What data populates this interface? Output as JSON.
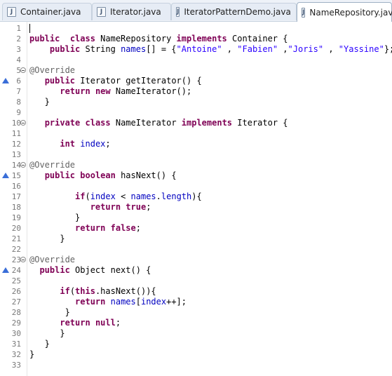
{
  "tabs": [
    {
      "label": "Container.java",
      "icon": "java-file-icon",
      "active": false
    },
    {
      "label": "Iterator.java",
      "icon": "java-file-icon",
      "active": false
    },
    {
      "label": "IteratorPatternDemo.java",
      "icon": "java-file-icon",
      "active": false
    },
    {
      "label": "NameRepository.java",
      "icon": "java-file-icon",
      "active": true
    }
  ],
  "lines": [
    {
      "n": "1",
      "t": []
    },
    {
      "n": "2",
      "t": [
        [
          "kw",
          "public"
        ],
        [
          "",
          "  "
        ],
        [
          "kw",
          "class"
        ],
        [
          "",
          " NameRepository "
        ],
        [
          "kw",
          "implements"
        ],
        [
          "",
          " Container {"
        ]
      ]
    },
    {
      "n": "3",
      "t": [
        [
          "",
          "    "
        ],
        [
          "kw",
          "public"
        ],
        [
          "",
          " String "
        ],
        [
          "fld",
          "names"
        ],
        [
          "",
          "[] = {"
        ],
        [
          "str",
          "\"Antoine\""
        ],
        [
          "",
          " , "
        ],
        [
          "str",
          "\"Fabien\""
        ],
        [
          "",
          " ,"
        ],
        [
          "str",
          "\"Joris\""
        ],
        [
          "",
          " , "
        ],
        [
          "str",
          "\"Yassine\""
        ],
        [
          "",
          "};"
        ]
      ]
    },
    {
      "n": "4",
      "t": []
    },
    {
      "n": "5",
      "fold": true,
      "t": [
        [
          "ann",
          "@Override"
        ]
      ]
    },
    {
      "n": "6",
      "override": true,
      "t": [
        [
          "",
          "   "
        ],
        [
          "kw",
          "public"
        ],
        [
          "",
          " Iterator getIterator() {"
        ]
      ]
    },
    {
      "n": "7",
      "t": [
        [
          "",
          "      "
        ],
        [
          "kw",
          "return"
        ],
        [
          "",
          " "
        ],
        [
          "kw",
          "new"
        ],
        [
          "",
          " NameIterator();"
        ]
      ]
    },
    {
      "n": "8",
      "t": [
        [
          "",
          "   }"
        ]
      ]
    },
    {
      "n": "9",
      "t": []
    },
    {
      "n": "10",
      "fold": true,
      "t": [
        [
          "",
          "   "
        ],
        [
          "kw",
          "private"
        ],
        [
          "",
          " "
        ],
        [
          "kw",
          "class"
        ],
        [
          "",
          " NameIterator "
        ],
        [
          "kw",
          "implements"
        ],
        [
          "",
          " Iterator {"
        ]
      ]
    },
    {
      "n": "11",
      "t": []
    },
    {
      "n": "12",
      "t": [
        [
          "",
          "      "
        ],
        [
          "kw",
          "int"
        ],
        [
          "",
          " "
        ],
        [
          "fld",
          "index"
        ],
        [
          "",
          ";"
        ]
      ]
    },
    {
      "n": "13",
      "t": []
    },
    {
      "n": "14",
      "fold": true,
      "t": [
        [
          "ann",
          "@Override"
        ]
      ]
    },
    {
      "n": "15",
      "override": true,
      "t": [
        [
          "",
          "   "
        ],
        [
          "kw",
          "public"
        ],
        [
          "",
          " "
        ],
        [
          "kw",
          "boolean"
        ],
        [
          "",
          " hasNext() {"
        ]
      ]
    },
    {
      "n": "16",
      "t": []
    },
    {
      "n": "17",
      "t": [
        [
          "",
          "         "
        ],
        [
          "kw",
          "if"
        ],
        [
          "",
          "("
        ],
        [
          "fld",
          "index"
        ],
        [
          "",
          " < "
        ],
        [
          "fld",
          "names"
        ],
        [
          "",
          "."
        ],
        [
          "fld",
          "length"
        ],
        [
          "",
          "){"
        ]
      ]
    },
    {
      "n": "18",
      "t": [
        [
          "",
          "            "
        ],
        [
          "kw",
          "return"
        ],
        [
          "",
          " "
        ],
        [
          "kw",
          "true"
        ],
        [
          "",
          ";"
        ]
      ]
    },
    {
      "n": "19",
      "t": [
        [
          "",
          "         }"
        ]
      ]
    },
    {
      "n": "20",
      "t": [
        [
          "",
          "         "
        ],
        [
          "kw",
          "return"
        ],
        [
          "",
          " "
        ],
        [
          "kw",
          "false"
        ],
        [
          "",
          ";"
        ]
      ]
    },
    {
      "n": "21",
      "t": [
        [
          "",
          "      }"
        ]
      ]
    },
    {
      "n": "22",
      "t": []
    },
    {
      "n": "23",
      "fold": true,
      "t": [
        [
          "ann",
          "@Override"
        ]
      ]
    },
    {
      "n": "24",
      "override": true,
      "t": [
        [
          "",
          "  "
        ],
        [
          "kw",
          "public"
        ],
        [
          "",
          " Object next() {"
        ]
      ]
    },
    {
      "n": "25",
      "t": []
    },
    {
      "n": "26",
      "t": [
        [
          "",
          "      "
        ],
        [
          "kw",
          "if"
        ],
        [
          "",
          "("
        ],
        [
          "kw",
          "this"
        ],
        [
          "",
          ".hasNext()){"
        ]
      ]
    },
    {
      "n": "27",
      "t": [
        [
          "",
          "         "
        ],
        [
          "kw",
          "return"
        ],
        [
          "",
          " "
        ],
        [
          "fld",
          "names"
        ],
        [
          "",
          "["
        ],
        [
          "fld",
          "index"
        ],
        [
          "",
          "++];"
        ]
      ]
    },
    {
      "n": "28",
      "t": [
        [
          "",
          "       }"
        ]
      ]
    },
    {
      "n": "29",
      "t": [
        [
          "",
          "      "
        ],
        [
          "kw",
          "return"
        ],
        [
          "",
          " "
        ],
        [
          "kw",
          "null"
        ],
        [
          "",
          ";"
        ]
      ]
    },
    {
      "n": "30",
      "t": [
        [
          "",
          "      }"
        ]
      ]
    },
    {
      "n": "31",
      "t": [
        [
          "",
          "   }"
        ]
      ]
    },
    {
      "n": "32",
      "t": [
        [
          "",
          "}"
        ]
      ]
    },
    {
      "n": "33",
      "t": []
    }
  ]
}
